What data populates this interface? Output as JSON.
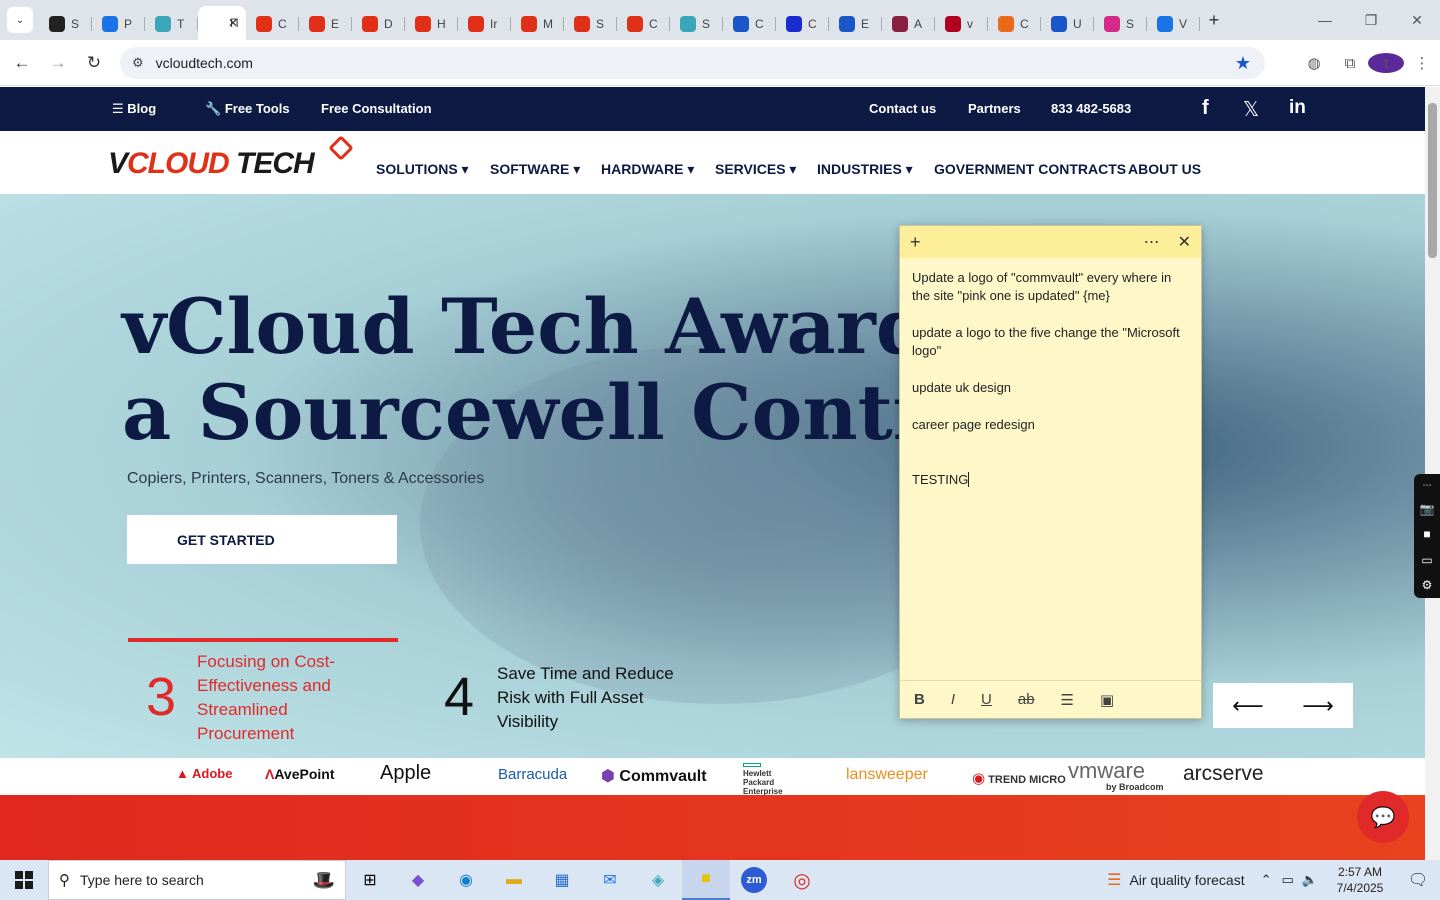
{
  "browser": {
    "tabs": [
      {
        "title": "S",
        "color": "#222"
      },
      {
        "title": "P",
        "color": "#1a73e8"
      },
      {
        "title": "T",
        "color": "#3aa6b9"
      },
      {
        "title": "П",
        "color": "#fff",
        "active": true
      },
      {
        "title": "C",
        "color": "#e03018"
      },
      {
        "title": "E",
        "color": "#e03018"
      },
      {
        "title": "D",
        "color": "#e03018"
      },
      {
        "title": "H",
        "color": "#e03018"
      },
      {
        "title": "Ir",
        "color": "#e03018"
      },
      {
        "title": "M",
        "color": "#e03018"
      },
      {
        "title": "S",
        "color": "#e03018"
      },
      {
        "title": "C",
        "color": "#e03018"
      },
      {
        "title": "S",
        "color": "#3aa6b9"
      },
      {
        "title": "C",
        "color": "#1a56c8"
      },
      {
        "title": "C",
        "color": "#1a2bd0"
      },
      {
        "title": "E",
        "color": "#1a56c8"
      },
      {
        "title": "A",
        "color": "#8a2040"
      },
      {
        "title": "v",
        "color": "#b00020"
      },
      {
        "title": "C",
        "color": "#e86a1a"
      },
      {
        "title": "U",
        "color": "#1a56c8"
      },
      {
        "title": "S",
        "color": "#d62a8a"
      },
      {
        "title": "V",
        "color": "#1a73e8"
      }
    ],
    "new_tab": "+",
    "url": "vcloudtech.com",
    "profile_initial": "t"
  },
  "site": {
    "topbar": {
      "blog": "Blog",
      "free_tools": "Free Tools",
      "free_consultation": "Free Consultation",
      "contact": "Contact us",
      "partners": "Partners",
      "phone": "833 482-5683"
    },
    "logo": {
      "v": "V",
      "cloud": "CLOUD ",
      "tech": "TECH"
    },
    "menu": [
      "SOLUTIONS",
      "SOFTWARE",
      "HARDWARE",
      "SERVICES",
      "INDUSTRIES",
      "GOVERNMENT CONTRACTS",
      "ABOUT US"
    ],
    "hero": {
      "line1": "vCloud Tech Awarde",
      "line2": "a Sourcewell Contra",
      "subtitle": "Copiers, Printers, Scanners, Toners & Accessories",
      "cta": "GET STARTED"
    },
    "features": [
      {
        "num": "3",
        "text": [
          "Focusing on Cost-",
          "Effectiveness and",
          "Streamlined",
          "Procurement"
        ],
        "active": true
      },
      {
        "num": "4",
        "text": [
          "Save Time and Reduce",
          "Risk with Full Asset",
          "Visibility"
        ]
      }
    ],
    "brands": [
      "Adobe",
      "AvePoint",
      "Apple",
      "Barracuda",
      "Commvault",
      "Hewlett Packard Enterprise",
      "lansweeper",
      "TREND MICRO",
      "vmware",
      "arcserve"
    ],
    "vmware_sub": "by Broadcom"
  },
  "sticky_note": {
    "lines": [
      "Update a logo of \"commvault\" every where in the site \"pink one is updated\" {me}",
      "update a logo to the five change the \"Microsoft logo\"",
      "update uk design",
      "career page redesign"
    ],
    "current": "TESTING "
  },
  "taskbar": {
    "search_placeholder": "Type here to search",
    "weather": "Air quality forecast",
    "time": "2:57 AM",
    "date": "7/4/2025"
  }
}
